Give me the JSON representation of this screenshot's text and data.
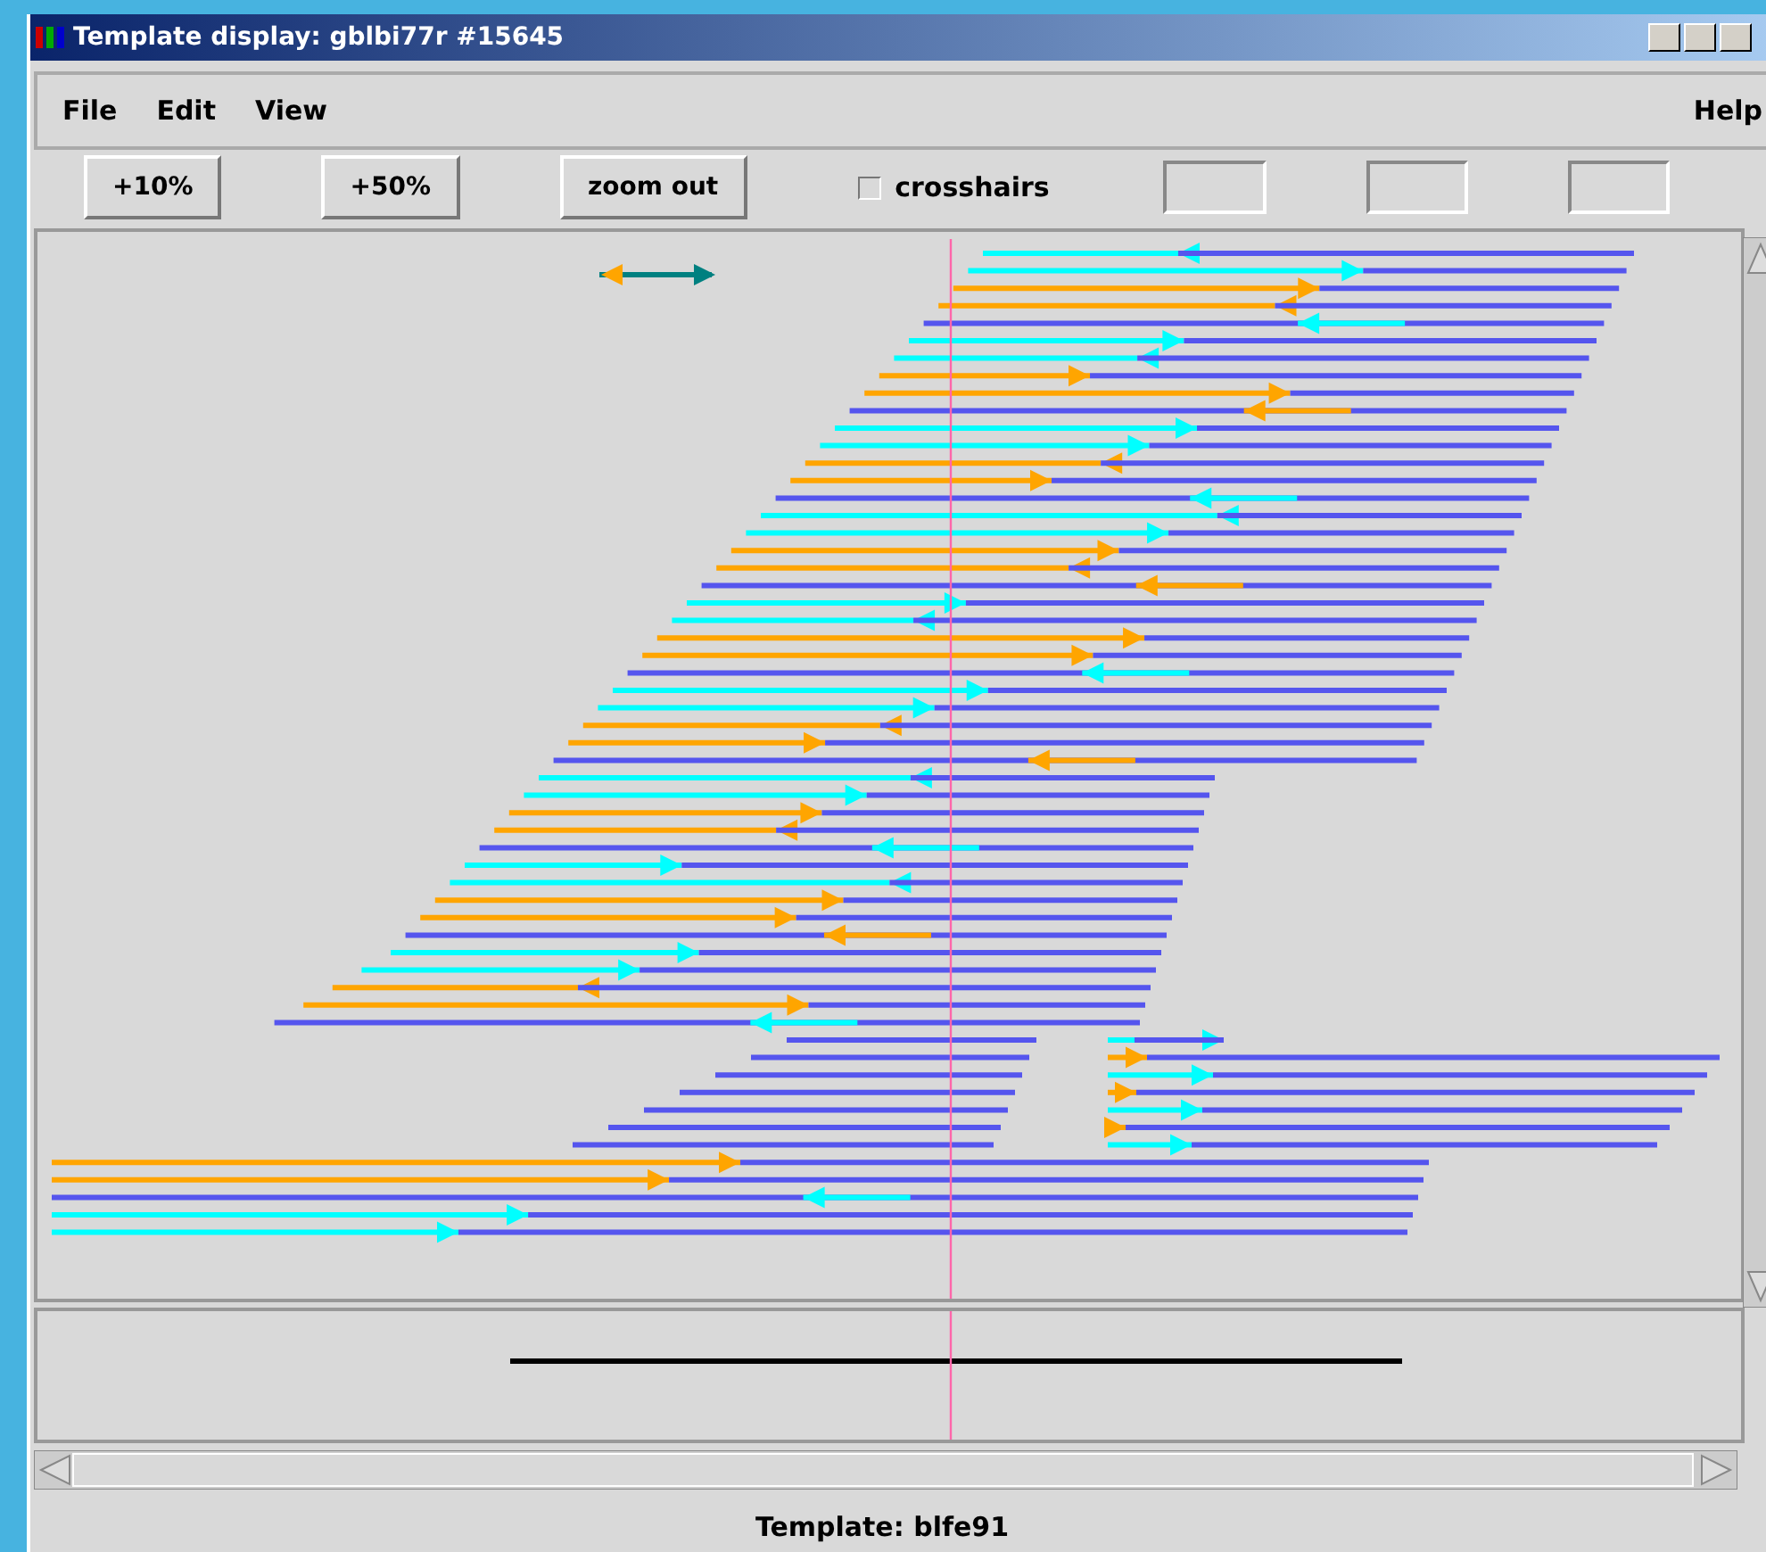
{
  "window": {
    "title": "Template display: gblbi77r #15645"
  },
  "menu": [
    {
      "label": "File"
    },
    {
      "label": "Edit"
    },
    {
      "label": "View"
    },
    {
      "label": "Help",
      "kind": "right"
    }
  ],
  "toolbar": {
    "buttons": [
      "+10%",
      "+50%",
      "zoom out"
    ],
    "crosshairs": {
      "label": "crosshairs",
      "checked": false
    }
  },
  "status_bar": {
    "text": "Template: blfe91"
  }
}
